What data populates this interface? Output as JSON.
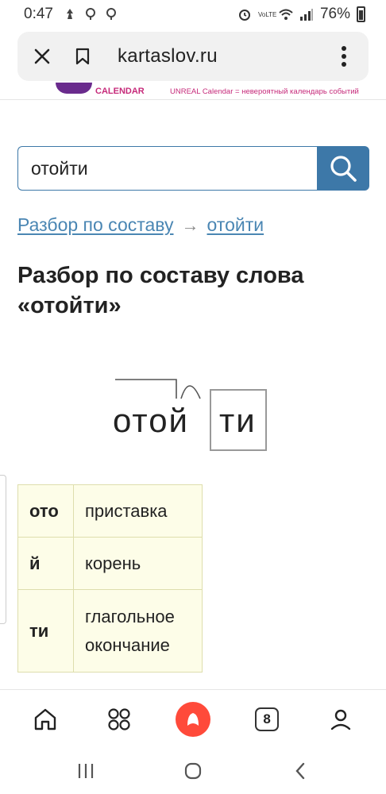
{
  "status_bar": {
    "time": "0:47",
    "battery": "76%",
    "network_label": "VoLTE"
  },
  "browser": {
    "host": "kartaslov.ru",
    "tabs_count": "8"
  },
  "banner": {
    "calendar_label": "CALENDAR",
    "ad_text": "UNREAL Calendar = невероятный календарь событий"
  },
  "search": {
    "value": "отойти"
  },
  "breadcrumb": {
    "parent": "Разбор по составу",
    "arrow": "→",
    "current": "отойти"
  },
  "page_title": "Разбор по составу слова «отойти»",
  "diagram": {
    "word_stem": "отой",
    "ending": "ти"
  },
  "morphemes": [
    {
      "part": "ото",
      "type": "приставка"
    },
    {
      "part": "й",
      "type": "корень"
    },
    {
      "part": "ти",
      "type": "глагольное окончание"
    }
  ],
  "colors": {
    "accent": "#3d78a8",
    "link": "#4a86b3",
    "table_bg": "#fdfde8",
    "alice": "#ff4a3a"
  },
  "icons": {
    "close": "close-icon",
    "bookmark": "bookmark-icon",
    "menu": "more-vertical-icon",
    "search": "search-icon",
    "home": "home-icon",
    "services": "grid-icon",
    "alice": "alice-icon",
    "profile": "profile-icon"
  }
}
